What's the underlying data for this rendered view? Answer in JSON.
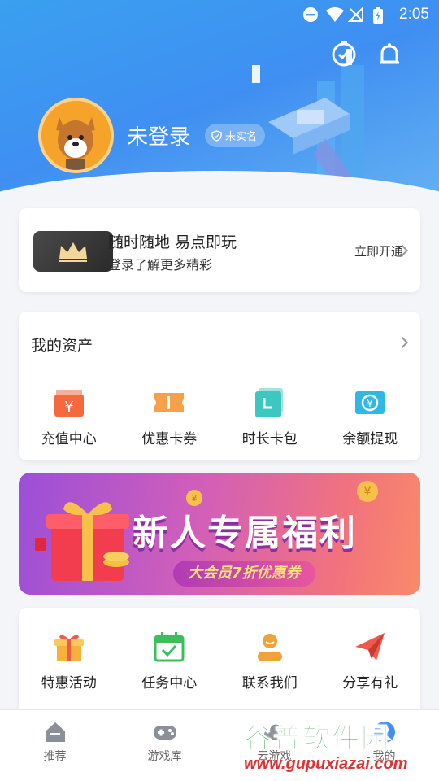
{
  "status_bar": {
    "time": "2:05"
  },
  "profile": {
    "username": "未登录",
    "verify_badge": "未实名"
  },
  "vip_card": {
    "title": "随时随地 易点即玩",
    "subtitle": "登录了解更多精彩",
    "action": "立即开通"
  },
  "assets": {
    "title": "我的资产",
    "items": [
      {
        "label": "充值中心",
        "icon": "recharge-icon",
        "color": "#f4693e"
      },
      {
        "label": "优惠卡券",
        "icon": "coupon-icon",
        "color": "#f6a14a"
      },
      {
        "label": "时长卡包",
        "icon": "time-card-icon",
        "color": "#3cc8c1"
      },
      {
        "label": "余额提现",
        "icon": "withdraw-icon",
        "color": "#2fb8e6"
      }
    ]
  },
  "banner": {
    "headline": "新人专属福利",
    "tagline": "大会员7折优惠券"
  },
  "services": {
    "items": [
      {
        "label": "特惠活动",
        "icon": "gift-icon",
        "color": "#f7b03a"
      },
      {
        "label": "任务中心",
        "icon": "calendar-check-icon",
        "color": "#3cbf5a"
      },
      {
        "label": "联系我们",
        "icon": "support-icon",
        "color": "#f0a23a"
      },
      {
        "label": "分享有礼",
        "icon": "paper-plane-icon",
        "color": "#f0584a"
      }
    ]
  },
  "tabbar": {
    "tabs": [
      {
        "label": "推荐",
        "icon": "home-icon"
      },
      {
        "label": "游戏库",
        "icon": "gamepad-icon"
      },
      {
        "label": "云游戏",
        "icon": "cloud-game-icon"
      },
      {
        "label": "我的",
        "icon": "profile-icon"
      }
    ]
  },
  "watermark": {
    "brand": "谷普软件园",
    "url": "www.gupuxiazai.com"
  },
  "colors": {
    "primary": "#3f8ff2",
    "banner_start": "#9b4fd8",
    "banner_end": "#f98a6a"
  }
}
